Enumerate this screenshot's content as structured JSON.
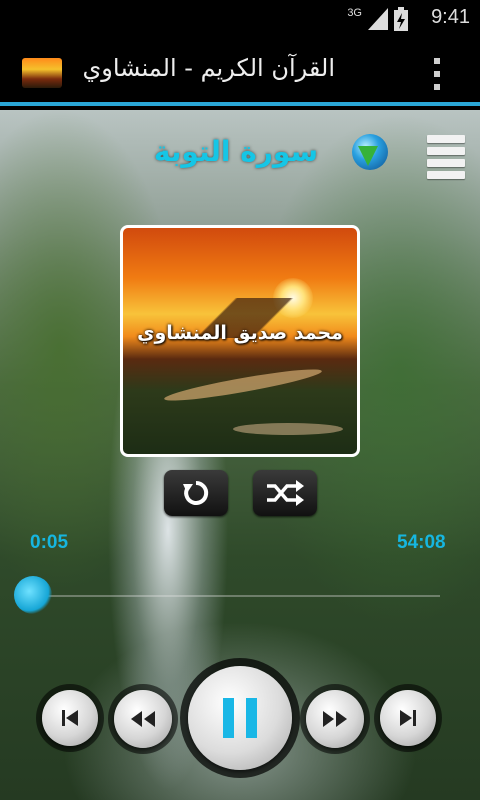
{
  "status_bar": {
    "network": "3G",
    "time": "9:41"
  },
  "action_bar": {
    "title": "القرآن الكريم - المنشاوي"
  },
  "player": {
    "surah_title": "سورة التوبة",
    "reciter": "محمد صديق المنشاوي",
    "elapsed": "0:05",
    "total": "54:08",
    "progress_fraction": 0.0015,
    "state": "playing"
  },
  "colors": {
    "accent": "#16b6e0",
    "action_bar_line": "#2aa7d7"
  },
  "icons": {
    "app": "app-sunset-icon",
    "overflow": "overflow-menu-icon",
    "download": "globe-download-icon",
    "playlist": "hamburger-menu-icon",
    "repeat": "repeat-icon",
    "shuffle": "shuffle-icon",
    "prev": "skip-previous-icon",
    "rewind": "rewind-icon",
    "pause": "pause-icon",
    "forward": "fast-forward-icon",
    "next": "skip-next-icon"
  }
}
